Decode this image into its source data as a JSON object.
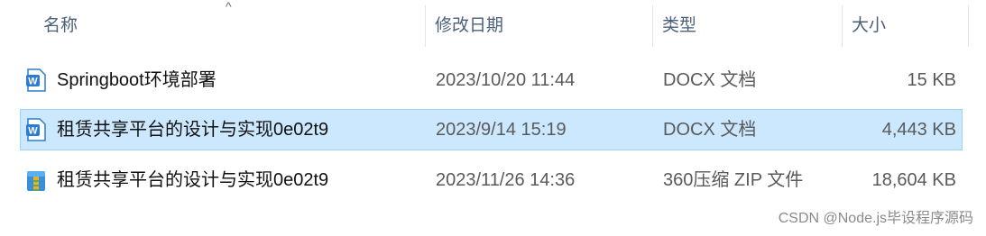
{
  "columns": {
    "name": "名称",
    "modified": "修改日期",
    "type": "类型",
    "size": "大小",
    "sort_indicator": "^"
  },
  "files": [
    {
      "name": "Springboot环境部署",
      "modified": "2023/10/20 11:44",
      "type": "DOCX 文档",
      "size": "15 KB",
      "icon": "word-document-icon",
      "selected": false
    },
    {
      "name": "租赁共享平台的设计与实现0e02t9",
      "modified": "2023/9/14 15:19",
      "type": "DOCX 文档",
      "size": "4,443 KB",
      "icon": "word-document-icon",
      "selected": true
    },
    {
      "name": "租赁共享平台的设计与实现0e02t9",
      "modified": "2023/11/26 14:36",
      "type": "360压缩 ZIP 文件",
      "size": "18,604 KB",
      "icon": "zip-archive-icon",
      "selected": false
    }
  ],
  "watermark": "CSDN @Node.js毕设程序源码",
  "colors": {
    "selection_bg": "#cce8ff",
    "selection_border": "#99d1ff",
    "word_blue": "#2b7cd3"
  }
}
